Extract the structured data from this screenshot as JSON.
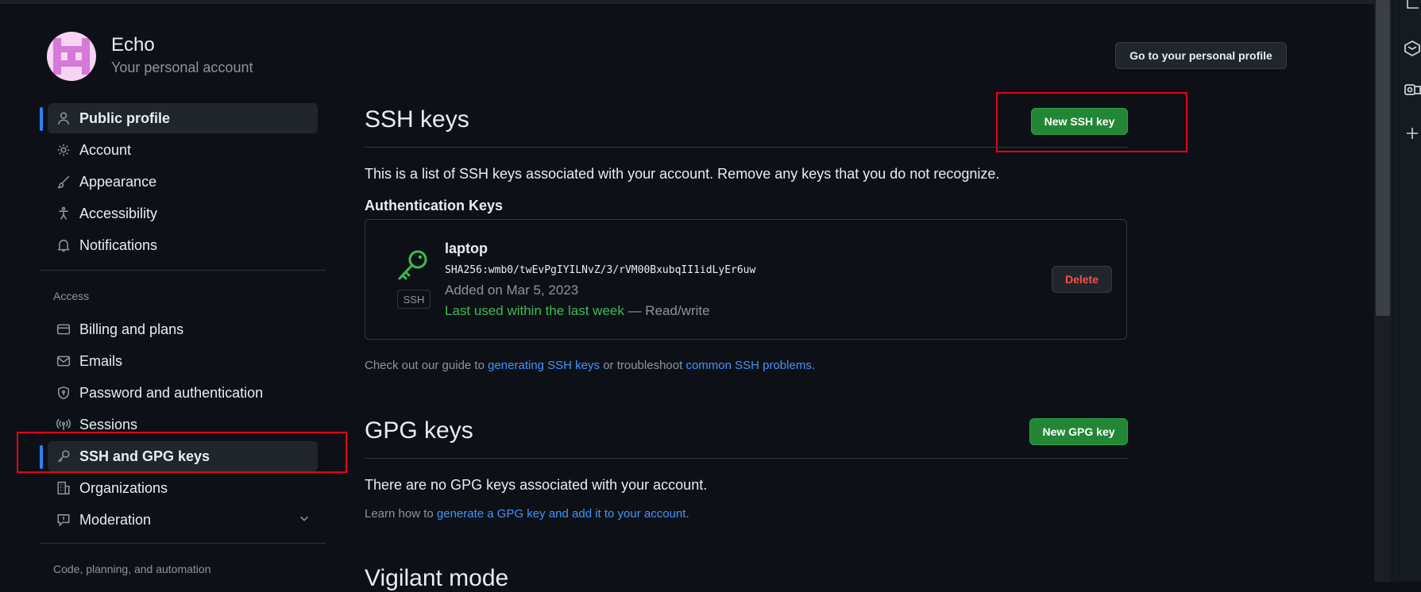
{
  "user": {
    "name": "Echo",
    "subtitle": "Your personal account"
  },
  "header": {
    "profile_button": "Go to your personal profile"
  },
  "sidebar": {
    "items": [
      {
        "label": "Public profile",
        "icon": "person-icon"
      },
      {
        "label": "Account",
        "icon": "gear-icon"
      },
      {
        "label": "Appearance",
        "icon": "paintbrush-icon"
      },
      {
        "label": "Accessibility",
        "icon": "accessibility-icon"
      },
      {
        "label": "Notifications",
        "icon": "bell-icon"
      }
    ],
    "access_label": "Access",
    "access_items": [
      {
        "label": "Billing and plans",
        "icon": "credit-card-icon"
      },
      {
        "label": "Emails",
        "icon": "mail-icon"
      },
      {
        "label": "Password and authentication",
        "icon": "shield-icon"
      },
      {
        "label": "Sessions",
        "icon": "broadcast-icon"
      },
      {
        "label": "SSH and GPG keys",
        "icon": "key-icon"
      },
      {
        "label": "Organizations",
        "icon": "organization-icon"
      },
      {
        "label": "Moderation",
        "icon": "report-icon"
      }
    ],
    "code_label": "Code, planning, and automation"
  },
  "ssh": {
    "title": "SSH keys",
    "new_button": "New SSH key",
    "description": "This is a list of SSH keys associated with your account. Remove any keys that you do not recognize.",
    "auth_heading": "Authentication Keys",
    "key": {
      "title": "laptop",
      "fingerprint": "SHA256:wmb0/twEvPgIYILNvZ/3/rVM00BxubqII1idLyEr6uw",
      "added": "Added on Mar 5, 2023",
      "last_used": "Last used within the last week",
      "access": " — Read/write",
      "badge": "SSH",
      "delete_button": "Delete"
    },
    "guide_prefix": "Check out our guide to ",
    "guide_link1": "generating SSH keys",
    "guide_middle": " or troubleshoot ",
    "guide_link2": "common SSH problems",
    "guide_suffix": "."
  },
  "gpg": {
    "title": "GPG keys",
    "new_button": "New GPG key",
    "empty_text": "There are no GPG keys associated with your account.",
    "learn_prefix": "Learn how to ",
    "learn_link": "generate a GPG key and add it to your account",
    "learn_suffix": "."
  },
  "vigilant": {
    "title": "Vigilant mode"
  },
  "colors": {
    "accent": "#2f81f7",
    "primary_button": "#238636",
    "danger": "#f85149",
    "link": "#4493f8",
    "highlight_box": "#e5001c"
  }
}
